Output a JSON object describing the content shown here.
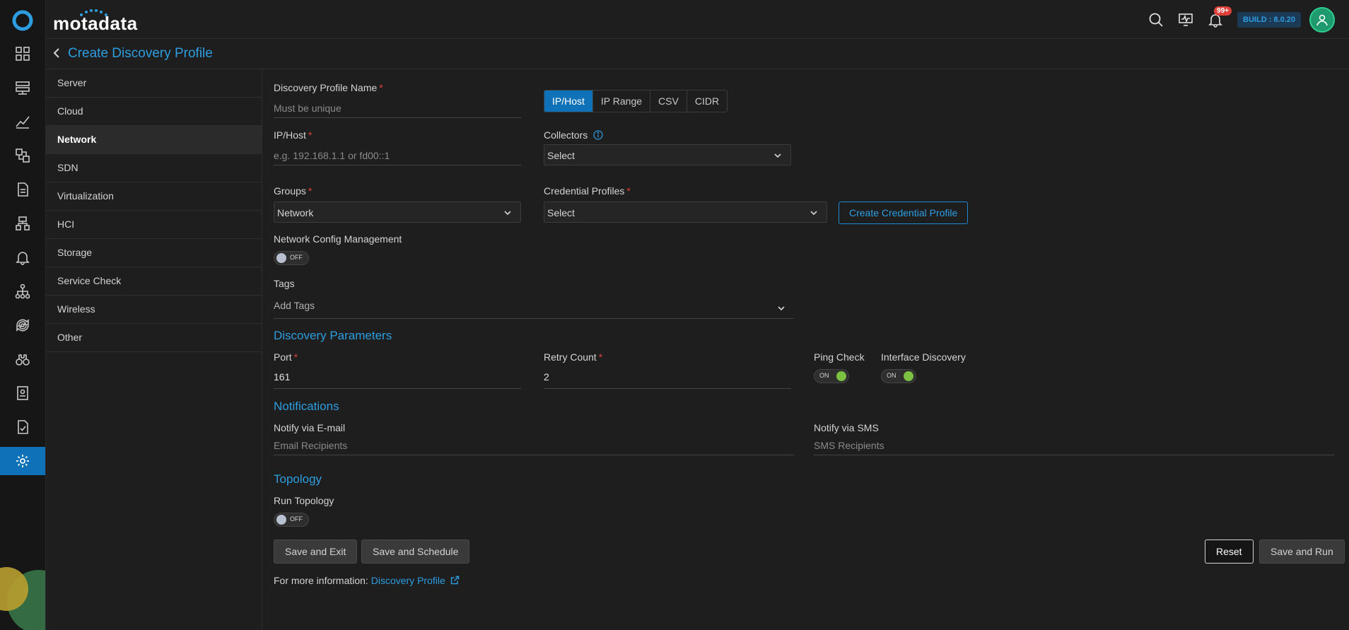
{
  "brand": {
    "name": "motadata"
  },
  "topbar": {
    "notification_badge": "99+",
    "build_label": "BUILD : 8.0.20"
  },
  "rail": {
    "icons": [
      "dashboard-icon",
      "server-icon",
      "metrics-icon",
      "flow-icon",
      "report-icon",
      "topology-icon",
      "alerts-icon",
      "network-icon",
      "sync-icon",
      "explorer-icon",
      "audit-icon",
      "tasks-icon",
      "settings-icon"
    ]
  },
  "page": {
    "title": "Create Discovery Profile"
  },
  "categories": [
    {
      "label": "Server"
    },
    {
      "label": "Cloud"
    },
    {
      "label": "Network"
    },
    {
      "label": "SDN"
    },
    {
      "label": "Virtualization"
    },
    {
      "label": "HCI"
    },
    {
      "label": "Storage"
    },
    {
      "label": "Service Check"
    },
    {
      "label": "Wireless"
    },
    {
      "label": "Other"
    }
  ],
  "form": {
    "profile_name": {
      "label": "Discovery Profile Name",
      "placeholder": "Must be unique"
    },
    "mode_tabs": [
      "IP/Host",
      "IP Range",
      "CSV",
      "CIDR"
    ],
    "ip_host": {
      "label": "IP/Host",
      "placeholder": "e.g. 192.168.1.1 or fd00::1"
    },
    "collectors": {
      "label": "Collectors",
      "value": "Select"
    },
    "groups": {
      "label": "Groups",
      "value": "Network"
    },
    "credential_profiles": {
      "label": "Credential Profiles",
      "value": "Select"
    },
    "create_credential_button": "Create Credential Profile",
    "ncm": {
      "label": "Network Config Management",
      "state": "OFF"
    },
    "tags": {
      "label": "Tags",
      "placeholder": "Add Tags"
    },
    "discovery_params_title": "Discovery Parameters",
    "port": {
      "label": "Port",
      "value": "161"
    },
    "retry_count": {
      "label": "Retry Count",
      "value": "2"
    },
    "ping_check": {
      "label": "Ping Check",
      "state": "ON"
    },
    "interface_discovery": {
      "label": "Interface Discovery",
      "state": "ON"
    },
    "notifications_title": "Notifications",
    "notify_email": {
      "label": "Notify via E-mail",
      "placeholder": "Email Recipients"
    },
    "notify_sms": {
      "label": "Notify via SMS",
      "placeholder": "SMS Recipients"
    },
    "topology_title": "Topology",
    "run_topology": {
      "label": "Run Topology",
      "state": "OFF"
    },
    "buttons": {
      "save_exit": "Save and Exit",
      "save_schedule": "Save and Schedule",
      "reset": "Reset",
      "save_run": "Save and Run"
    },
    "more_info": {
      "prefix": "For more information:",
      "link": "Discovery Profile"
    }
  },
  "colors": {
    "accent": "#2d9de0",
    "active_tab": "#0f72b8",
    "required": "#e0403a",
    "toggle_on": "#7bc142"
  }
}
